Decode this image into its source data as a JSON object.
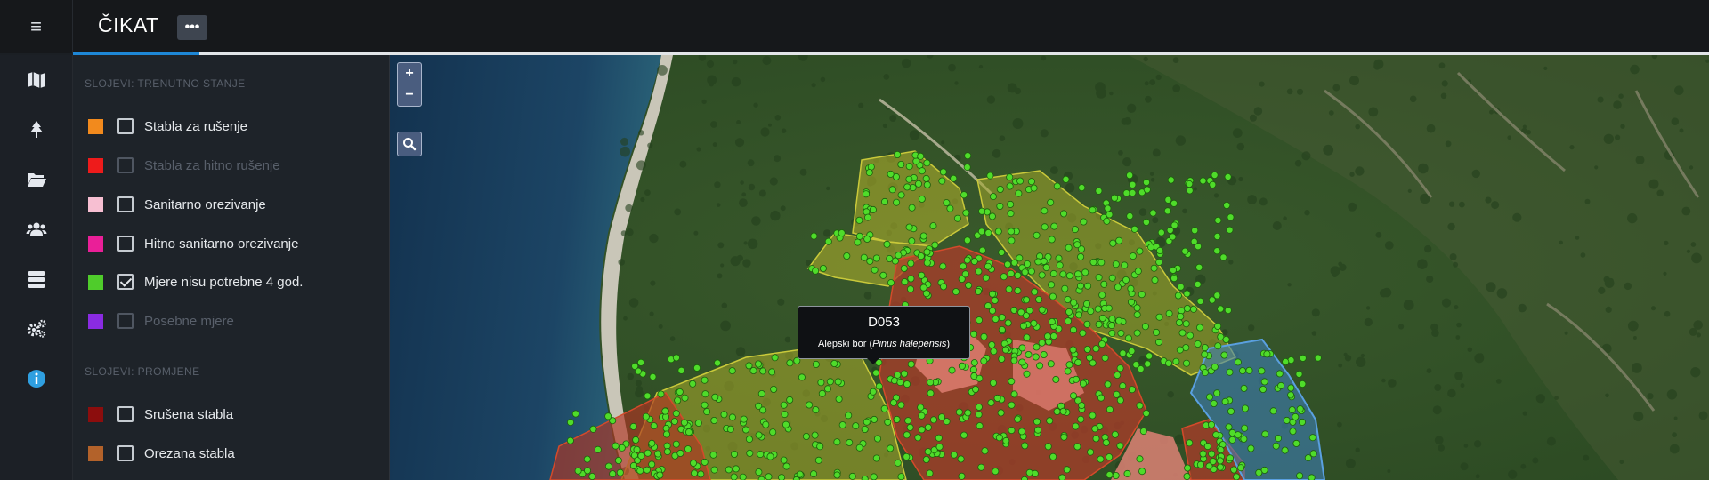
{
  "app": {
    "title": "ČIKAT",
    "menu_icon": "hamburger-icon",
    "more_label": "•••",
    "loading_progress": 0.077
  },
  "rail": {
    "items": [
      {
        "icon": "map-icon"
      },
      {
        "icon": "tree-icon"
      },
      {
        "icon": "folder-icon"
      },
      {
        "icon": "users-icon"
      },
      {
        "icon": "database-icon"
      },
      {
        "icon": "settings-icon"
      },
      {
        "icon": "info-icon"
      }
    ]
  },
  "layers": {
    "current_title": "SLOJEVI: TRENUTNO STANJE",
    "current": [
      {
        "label": "Stabla za rušenje",
        "color": "#f28a1d",
        "checked": false,
        "disabled": false
      },
      {
        "label": "Stabla za hitno rušenje",
        "color": "#ee1b1b",
        "checked": false,
        "disabled": true
      },
      {
        "label": "Sanitarno orezivanje",
        "color": "#f7bfd2",
        "checked": false,
        "disabled": false
      },
      {
        "label": "Hitno sanitarno orezivanje",
        "color": "#ea1f98",
        "checked": false,
        "disabled": false
      },
      {
        "label": "Mjere nisu potrebne 4 god.",
        "color": "#4fcc2b",
        "checked": true,
        "disabled": false
      },
      {
        "label": "Posebne mjere",
        "color": "#8a2be2",
        "checked": false,
        "disabled": true
      }
    ],
    "changes_title": "SLOJEVI: PROMJENE",
    "changes": [
      {
        "label": "Srušena stabla",
        "color": "#8c0d0d",
        "checked": false,
        "disabled": false
      },
      {
        "label": "Orezana stabla",
        "color": "#b3622a",
        "checked": false,
        "disabled": false
      }
    ]
  },
  "map": {
    "zoom_in_label": "+",
    "zoom_out_label": "−",
    "search_icon": "search-icon",
    "tooltip": {
      "code": "D053",
      "name": "Alepski bor",
      "latin": "Pinus halepensis"
    }
  }
}
